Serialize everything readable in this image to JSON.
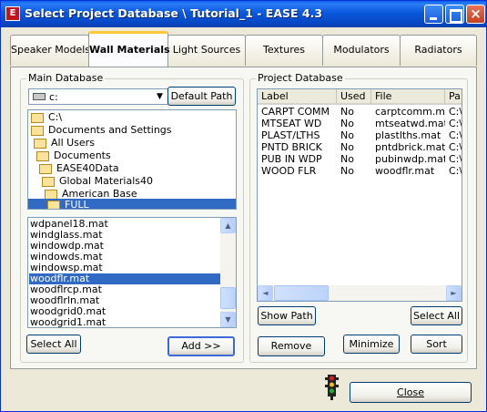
{
  "window": {
    "title": "Select Project Database \\ Tutorial_1 - EASE 4.3",
    "icon": "ease-app-icon",
    "controls": {
      "minimize": "minimize-icon",
      "maximize": "maximize-icon",
      "close": "×"
    }
  },
  "tabs": [
    {
      "label": "Speaker Models",
      "active": false
    },
    {
      "label": "Wall Materials",
      "active": true
    },
    {
      "label": "Light Sources",
      "active": false
    },
    {
      "label": "Textures",
      "active": false
    },
    {
      "label": "Modulators",
      "active": false
    },
    {
      "label": "Radiators",
      "active": false
    }
  ],
  "main_db": {
    "label": "Main Database",
    "drive_value": "c:",
    "drive_arrow": "▼",
    "default_path_label": "Default Path",
    "tree": [
      {
        "label": "C:\\",
        "selected": false
      },
      {
        "label": "Documents and Settings",
        "selected": false
      },
      {
        "label": "All Users",
        "selected": false
      },
      {
        "label": "Documents",
        "selected": false
      },
      {
        "label": "EASE40Data",
        "selected": false
      },
      {
        "label": "Global Materials40",
        "selected": false
      },
      {
        "label": "American Base",
        "selected": false
      },
      {
        "label": "FULL",
        "selected": true
      }
    ],
    "files": [
      {
        "name": "wdpanel18.mat",
        "selected": false
      },
      {
        "name": "windglass.mat",
        "selected": false
      },
      {
        "name": "windowdp.mat",
        "selected": false
      },
      {
        "name": "windowds.mat",
        "selected": false
      },
      {
        "name": "windowsp.mat",
        "selected": false
      },
      {
        "name": "woodflr.mat",
        "selected": true
      },
      {
        "name": "woodflrcp.mat",
        "selected": false
      },
      {
        "name": "woodflrln.mat",
        "selected": false
      },
      {
        "name": "woodgrid0.mat",
        "selected": false
      },
      {
        "name": "woodgrid1.mat",
        "selected": false
      }
    ],
    "scroll_up": "▲",
    "scroll_down": "▼",
    "select_all_label": "Select All",
    "add_label": "Add >>"
  },
  "project_db": {
    "label": "Project Database",
    "columns": [
      "Label",
      "Used",
      "File",
      "Pa"
    ],
    "rows": [
      {
        "label": "CARPT COMM",
        "used": "No",
        "file": "carptcomm.mat",
        "path": "C:\\"
      },
      {
        "label": "MTSEAT WD",
        "used": "No",
        "file": "mtseatwd.mat",
        "path": "C:\\"
      },
      {
        "label": "PLAST/LTHS",
        "used": "No",
        "file": "plastlths.mat",
        "path": "C:\\"
      },
      {
        "label": "PNTD BRICK",
        "used": "No",
        "file": "pntdbrick.mat",
        "path": "C:\\"
      },
      {
        "label": "PUB IN WDP",
        "used": "No",
        "file": "pubinwdp.mat",
        "path": "C:\\"
      },
      {
        "label": "WOOD FLR",
        "used": "No",
        "file": "woodflr.mat",
        "path": "C:\\"
      }
    ],
    "scroll_left": "◄",
    "scroll_right": "►",
    "show_path_label": "Show Path",
    "select_all_label": "Select All",
    "remove_label": "Remove",
    "minimize_label": "Minimize",
    "sort_label": "Sort"
  },
  "footer": {
    "traffic_icon": "traffic-light-icon",
    "close_label": "Close"
  }
}
